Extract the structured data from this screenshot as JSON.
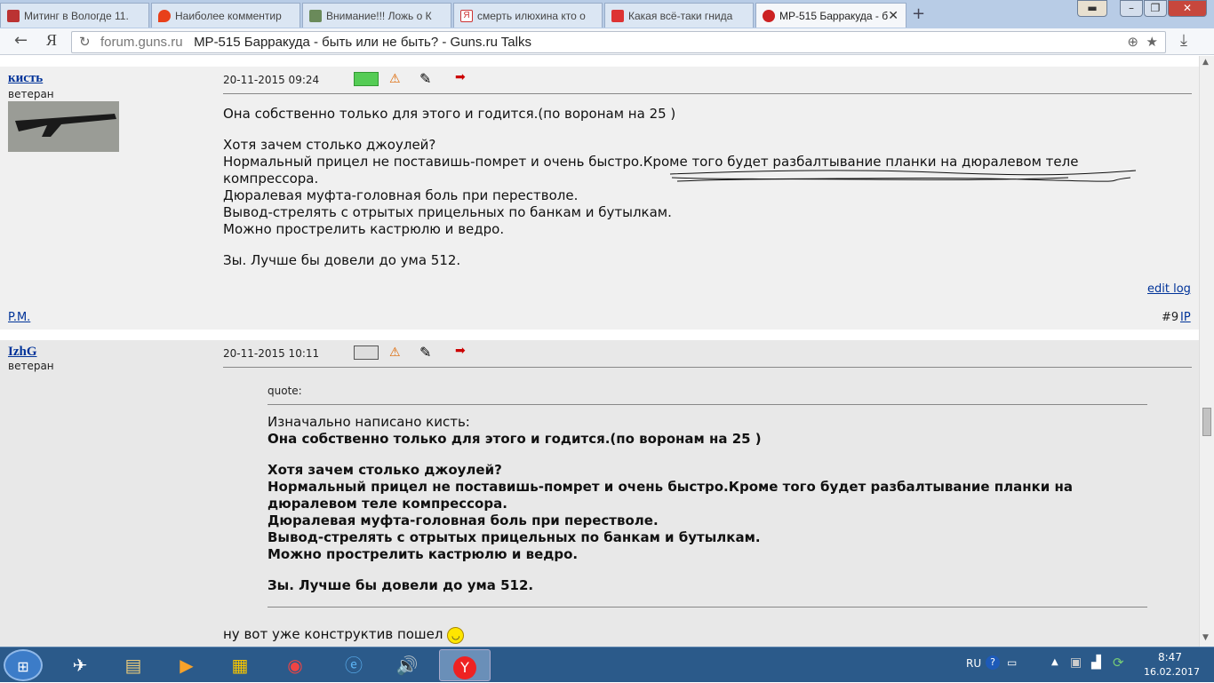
{
  "browser": {
    "tabs": [
      {
        "label": "Митинг в Вологде 11."
      },
      {
        "label": "Наиболее комментир"
      },
      {
        "label": "Внимание!!! Ложь о К"
      },
      {
        "label": "смерть илюхина кто о"
      },
      {
        "label": "Какая всё-таки гнида"
      },
      {
        "label": "МР-515 Барракуда - б"
      }
    ],
    "new_tab": "+",
    "nav_logo": "Я",
    "url_domain": "forum.guns.ru",
    "url_title": "МР-515 Барракуда - быть или не быть? - Guns.ru Talks"
  },
  "post1": {
    "author": "кисть",
    "rank": "ветеран",
    "date": "20-11-2015 09:24",
    "paragraphs": [
      [
        "Она собственно только для этого и годится.(по воронам на 25 )"
      ],
      [
        "Хотя зачем столько джоулей?",
        "Нормальный прицел не поставишь-помрет и очень быстро.Кроме того будет разбалтывание планки на дюралевом теле",
        "компрессора.",
        "Дюралевая муфта-головная боль при перестволе.",
        "Вывод-стрелять с отрытых прицельных по банкам и бутылкам.",
        "Можно прострелить кастрюлю и ведро."
      ],
      [
        "Зы. Лучше бы довели до ума 512."
      ]
    ],
    "edit_log": "edit log",
    "pm": "P.M.",
    "post_num": "#9",
    "ip": "IP"
  },
  "post2": {
    "author": "IzhG",
    "rank": "ветеран",
    "date": "20-11-2015 10:11",
    "quote_label": "quote:",
    "quote_intro": "Изначально написано кисть:",
    "quote_paragraphs": [
      [
        "Она собственно только для этого и годится.(по воронам на 25 )"
      ],
      [
        "Хотя зачем столько джоулей?",
        "Нормальный прицел не поставишь-помрет и очень быстро.Кроме того будет разбалтывание планки на",
        "дюралевом теле компрессора.",
        "Дюралевая муфта-головная боль при перестволе.",
        "Вывод-стрелять с отрытых прицельных по банкам и бутылкам.",
        "Можно прострелить кастрюлю и ведро."
      ],
      [
        "Зы. Лучше бы довели до ума 512."
      ]
    ],
    "reply": "ну вот уже конструктив пошел"
  },
  "taskbar": {
    "lang": "RU",
    "time": "8:47",
    "date": "16.02.2017"
  },
  "colors": {
    "link": "#003399",
    "post1_bg": "#f0f0f0",
    "post2_bg": "#e8e8e8",
    "taskbar": "#2b5a8a"
  }
}
